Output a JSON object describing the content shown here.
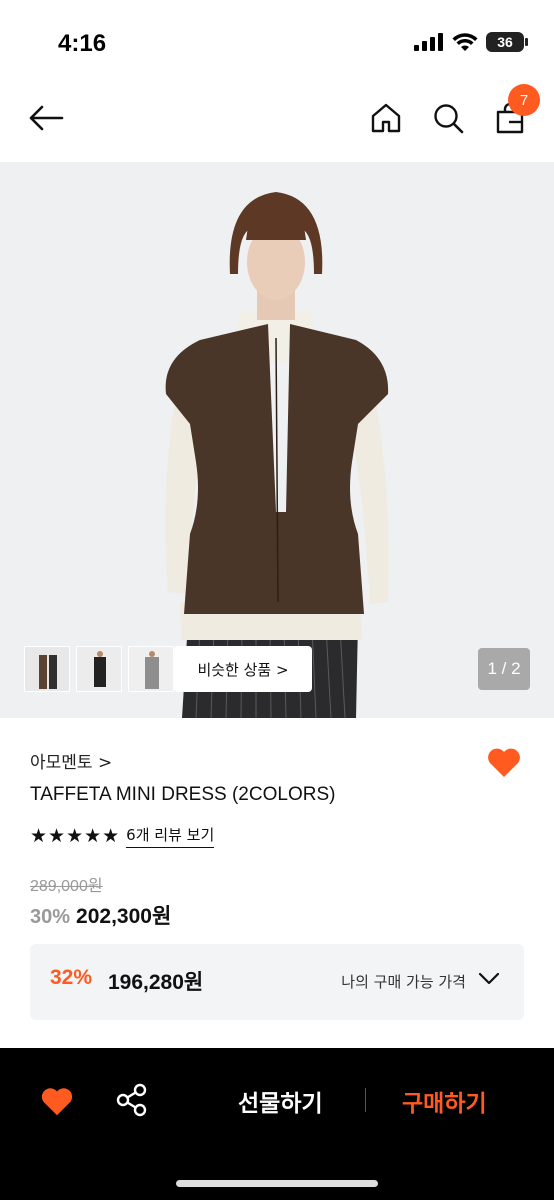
{
  "status_bar": {
    "time": "4:16",
    "battery": "36"
  },
  "nav": {
    "cart_count": "7"
  },
  "gallery": {
    "similar_label": "비슷한 상품 >",
    "page_indicator": "1 / 2"
  },
  "product": {
    "brand": "아모멘토 >",
    "name": "TAFFETA MINI DRESS (2COLORS)",
    "stars": "★★★★★",
    "rating": 5,
    "review_link": "6개 리뷰 보기",
    "original_price": "289,000원",
    "discount_pct": "30%",
    "sale_price": "202,300원"
  },
  "coupon": {
    "pct": "32%",
    "price": "196,280원",
    "label": "나의 구매 가능 가격"
  },
  "bottom_bar": {
    "gift_label": "선물하기",
    "buy_label": "구매하기"
  },
  "colors": {
    "accent": "#ff5a1f",
    "bar_bg": "#000000",
    "coupon_bg": "#f3f4f5"
  }
}
